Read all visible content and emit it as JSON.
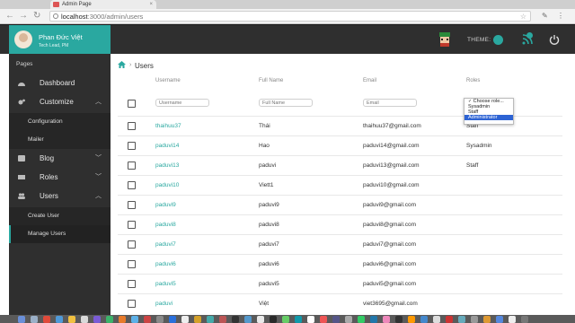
{
  "browser": {
    "tab_title": "Admin Page",
    "url_host": "localhost",
    "url_path": ":3000/admin/users"
  },
  "profile": {
    "name": "Phan Đức Việt",
    "role": "Tech Lead, PM"
  },
  "header": {
    "theme_label": "THEME:",
    "accent_color": "#2aa8a0"
  },
  "sidebar": {
    "heading": "Pages",
    "items": [
      {
        "label": "Dashboard",
        "icon": "dashboard-icon"
      },
      {
        "label": "Customize",
        "icon": "gears-icon"
      },
      {
        "label": "Configuration"
      },
      {
        "label": "Mailer"
      },
      {
        "label": "Blog",
        "icon": "blog-icon"
      },
      {
        "label": "Roles",
        "icon": "roles-icon"
      },
      {
        "label": "Users",
        "icon": "users-icon"
      },
      {
        "label": "Create User"
      },
      {
        "label": "Manage Users"
      }
    ]
  },
  "breadcrumb": {
    "current": "Users"
  },
  "table": {
    "columns": [
      "Username",
      "Full Name",
      "Email",
      "Roles"
    ],
    "filters": {
      "username_placeholder": "Username",
      "fullname_placeholder": "Full Name",
      "email_placeholder": "Email"
    },
    "role_options": [
      "Choose role...",
      "Sysadmin",
      "Staff",
      "Administrator"
    ],
    "rows": [
      {
        "username": "thaihuu37",
        "fullname": "Thái",
        "email": "thaihuu37@gmail.com",
        "role": "Staff"
      },
      {
        "username": "paduvi14",
        "fullname": "Hao",
        "email": "paduvi14@gmail.com",
        "role": "Sysadmin"
      },
      {
        "username": "paduvi13",
        "fullname": "paduvi",
        "email": "paduvi13@gmail.com",
        "role": "Staff"
      },
      {
        "username": "paduvi10",
        "fullname": "Viett1",
        "email": "paduvi10@gmail.com",
        "role": ""
      },
      {
        "username": "paduvi9",
        "fullname": "paduvi9",
        "email": "paduvi9@gmail.com",
        "role": ""
      },
      {
        "username": "paduvi8",
        "fullname": "paduvi8",
        "email": "paduvi8@gmail.com",
        "role": ""
      },
      {
        "username": "paduvi7",
        "fullname": "paduvi7",
        "email": "paduvi7@gmail.com",
        "role": ""
      },
      {
        "username": "paduvi6",
        "fullname": "paduvi6",
        "email": "paduvi6@gmail.com",
        "role": ""
      },
      {
        "username": "paduvi5",
        "fullname": "paduvi5",
        "email": "paduvi5@gmail.com",
        "role": ""
      },
      {
        "username": "paduvi",
        "fullname": "Việt",
        "email": "viet3695@gmail.com",
        "role": ""
      }
    ]
  }
}
